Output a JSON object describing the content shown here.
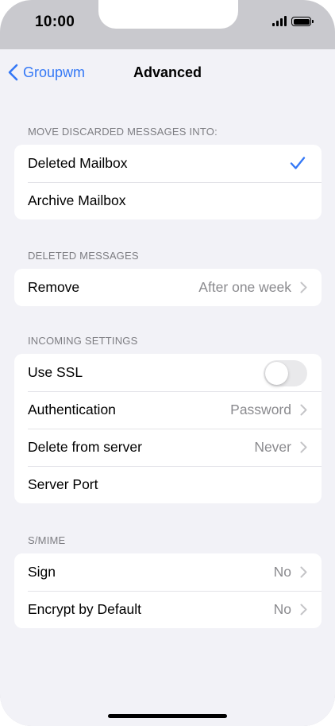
{
  "status_bar": {
    "time": "10:00"
  },
  "nav": {
    "back_label": "Groupwm",
    "title": "Advanced"
  },
  "sections": {
    "discarded": {
      "header": "MOVE DISCARDED MESSAGES INTO:",
      "rows": [
        {
          "label": "Deleted Mailbox",
          "selected": true
        },
        {
          "label": "Archive Mailbox",
          "selected": false
        }
      ]
    },
    "deleted": {
      "header": "DELETED MESSAGES",
      "rows": [
        {
          "label": "Remove",
          "value": "After one week"
        }
      ]
    },
    "incoming": {
      "header": "INCOMING SETTINGS",
      "rows": [
        {
          "label": "Use SSL",
          "toggle_on": false
        },
        {
          "label": "Authentication",
          "value": "Password"
        },
        {
          "label": "Delete from server",
          "value": "Never"
        },
        {
          "label": "Server Port",
          "value": ""
        }
      ]
    },
    "smime": {
      "header": "S/MIME",
      "rows": [
        {
          "label": "Sign",
          "value": "No"
        },
        {
          "label": "Encrypt by Default",
          "value": "No"
        }
      ]
    }
  },
  "icons": {
    "back": "chevron-left-icon",
    "disclosure": "chevron-right-icon",
    "selected": "checkmark-icon"
  },
  "colors": {
    "accent": "#3478f6",
    "background": "#f2f2f7",
    "secondary_text": "#8a8a8e"
  }
}
